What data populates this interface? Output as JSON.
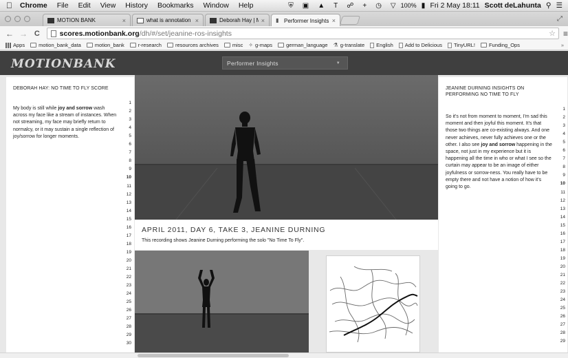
{
  "menubar": {
    "app_name": "Chrome",
    "items": [
      "File",
      "Edit",
      "View",
      "History",
      "Bookmarks",
      "Window",
      "Help"
    ],
    "battery": "100%",
    "datetime": "Fri 2 May  18:11",
    "user": "Scott deLahunta"
  },
  "tabs": [
    {
      "label": "MOTION BANK",
      "favicon": "motionbank-icon",
      "active": false
    },
    {
      "label": "what is annotation - Goo",
      "favicon": "document-icon",
      "active": false
    },
    {
      "label": "Deborah Hay | MOTION B",
      "favicon": "motionbank-icon",
      "active": false
    },
    {
      "label": "Performer Insights - Usin",
      "favicon": "pin-icon",
      "active": true
    }
  ],
  "address": {
    "host": "scores.motionbank.org",
    "path": "/dh/#/set/jeanine-ros-insights"
  },
  "bookmarks": [
    {
      "label": "Apps",
      "icon": "apps-icon"
    },
    {
      "label": "motion_bank_data",
      "icon": "folder-icon"
    },
    {
      "label": "motion_bank",
      "icon": "folder-icon"
    },
    {
      "label": "r-research",
      "icon": "folder-icon"
    },
    {
      "label": "resources archives",
      "icon": "folder-icon"
    },
    {
      "label": "misc",
      "icon": "folder-icon"
    },
    {
      "label": "g-maps",
      "icon": "maps-icon"
    },
    {
      "label": "german_language",
      "icon": "folder-icon"
    },
    {
      "label": "g-translate",
      "icon": "translate-icon"
    },
    {
      "label": "English",
      "icon": "page-icon"
    },
    {
      "label": "Add to Delicious",
      "icon": "page-icon"
    },
    {
      "label": "TinyURL!",
      "icon": "page-icon"
    },
    {
      "label": "Funding_Ops",
      "icon": "folder-icon"
    }
  ],
  "site": {
    "logo": "MOTIONBANK",
    "selector": "Performer Insights"
  },
  "left_panel": {
    "title": "DEBORAH HAY: NO TIME TO FLY SCORE",
    "note_before": "My body is still while ",
    "note_bold": "joy and sorrow",
    "note_after": " wash across my face like a stream of instances. When not streaming, my face may briefly return to normalcy, or it may sustain a single reflection of joy/sorrow for longer moments.",
    "line_numbers": [
      "1",
      "2",
      "3",
      "4",
      "5",
      "6",
      "7",
      "8",
      "9",
      "10",
      "11",
      "12",
      "13",
      "14",
      "15",
      "16",
      "17",
      "18",
      "19",
      "20",
      "21",
      "22",
      "23",
      "24",
      "25",
      "26",
      "27",
      "28",
      "29",
      "30"
    ],
    "highlight_line": "10"
  },
  "right_panel": {
    "title": "JEANINE DURNING INSIGHTS ON PERFORMING NO TIME TO FLY",
    "note_before": "So it's not from moment to moment, I'm sad this moment and then joyful this moment. It's that those two things are co-existing always. And one never achieves, never fully achieves one or the other. I also see ",
    "note_bold1": "joy and sorrow",
    "note_mid": " happening in the space, not just in my experience but it is happening all the time in who or what I see so the curtain may appear to be an image of either joyfulness or sorrow-ness. You really have to be empty there and not have a notion of how it's going to go.",
    "line_numbers": [
      "1",
      "2",
      "3",
      "4",
      "5",
      "6",
      "7",
      "8",
      "9",
      "10",
      "11",
      "12",
      "13",
      "14",
      "15",
      "16",
      "17",
      "18",
      "19",
      "20",
      "21",
      "22",
      "23",
      "24",
      "25",
      "26",
      "27",
      "28",
      "29"
    ],
    "highlight_line": "10"
  },
  "video": {
    "title": "APRIL 2011, DAY 6, TAKE 3, JEANINE DURNING",
    "description": "This recording shows Jeanine Durning performing the solo \"No Time To Fly\"."
  }
}
